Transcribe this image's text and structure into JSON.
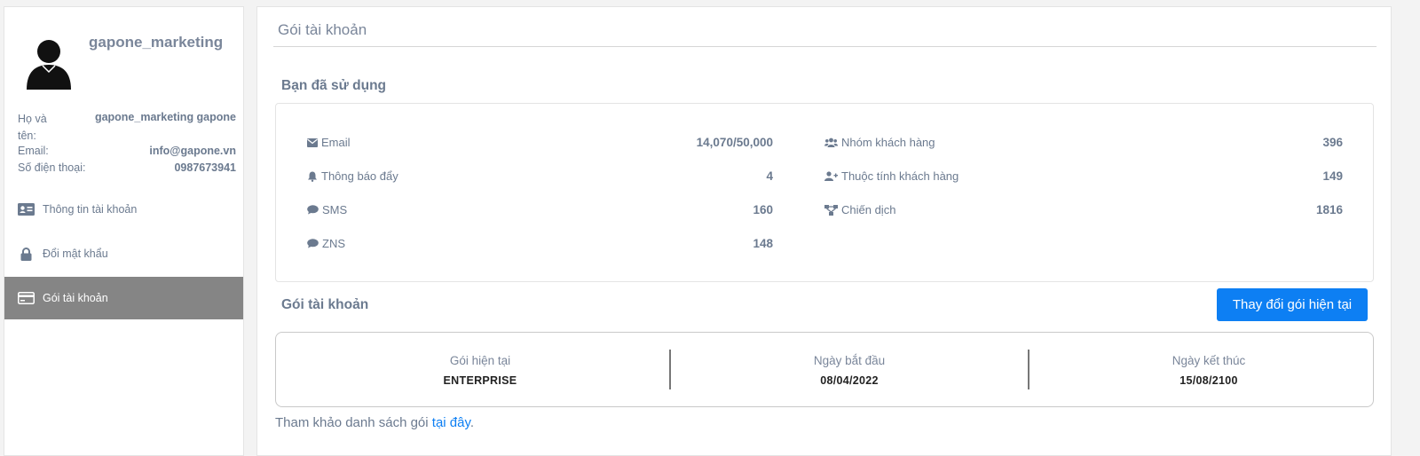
{
  "sidebar": {
    "username": "gapone_marketing",
    "info": {
      "name_label": "Họ và tên:",
      "name_value": "gapone_marketing gapone",
      "email_label": "Email:",
      "email_value": "info@gapone.vn",
      "phone_label": "Số điện thoại:",
      "phone_value": "0987673941"
    },
    "menu": [
      {
        "label": "Thông tin tài khoản",
        "icon": "id-card-icon"
      },
      {
        "label": "Đổi mật khẩu",
        "icon": "lock-icon"
      },
      {
        "label": "Gói tài khoản",
        "icon": "credit-card-icon",
        "active": true
      }
    ]
  },
  "main": {
    "page_title": "Gói tài khoản",
    "usage_title": "Bạn đã sử dụng",
    "usage_left": [
      {
        "label": "Email",
        "value": "14,070/50,000",
        "icon": "envelope-icon"
      },
      {
        "label": "Thông báo đẩy",
        "value": "4",
        "icon": "bell-icon"
      },
      {
        "label": "SMS",
        "value": "160",
        "icon": "comment-icon"
      },
      {
        "label": "ZNS",
        "value": "148",
        "icon": "comment-icon"
      }
    ],
    "usage_right": [
      {
        "label": "Nhóm khách hàng",
        "value": "396",
        "icon": "users-icon"
      },
      {
        "label": "Thuộc tính khách hàng",
        "value": "149",
        "icon": "user-plus-icon"
      },
      {
        "label": "Chiến dịch",
        "value": "1816",
        "icon": "sitemap-icon"
      }
    ],
    "plan_title": "Gói tài khoản",
    "change_button": "Thay đổi gói hiện tại",
    "plan": [
      {
        "label": "Gói hiện tại",
        "value": "ENTERPRISE"
      },
      {
        "label": "Ngày bắt đầu",
        "value": "08/04/2022"
      },
      {
        "label": "Ngày kết thúc",
        "value": "15/08/2100"
      }
    ],
    "reference_text": "Tham khảo danh sách gói ",
    "reference_link": "tại đây",
    "reference_suffix": "."
  },
  "colors": {
    "accent": "#0d7ff3",
    "active_menu_bg": "#858585",
    "text": "#6b7a8f"
  }
}
